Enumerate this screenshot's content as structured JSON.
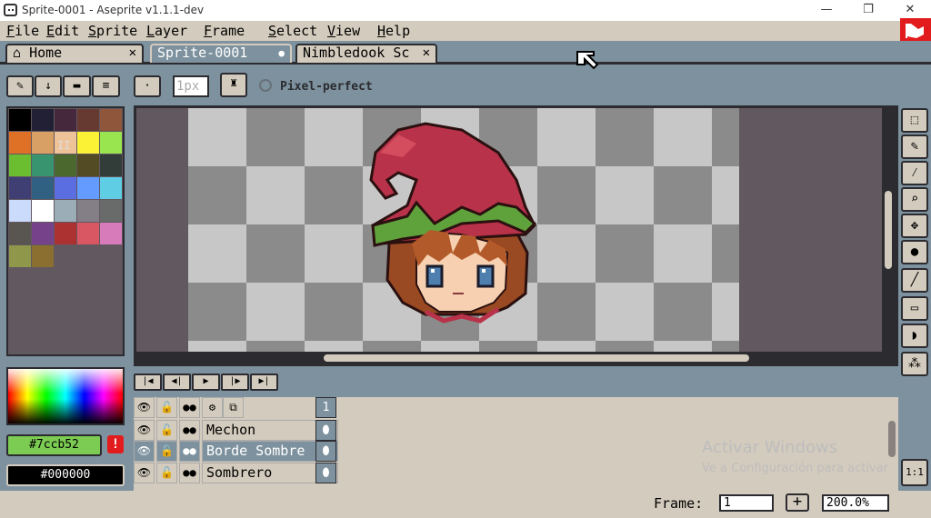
{
  "window": {
    "title": "Sprite-0001 - Aseprite v1.1.1-dev",
    "minimize": "—",
    "maximize": "❐",
    "close": "✕"
  },
  "menu": {
    "file": {
      "u": "F",
      "rest": "ile"
    },
    "edit": {
      "u": "E",
      "rest": "dit"
    },
    "sprite": {
      "u": "S",
      "rest": "prite"
    },
    "layer": {
      "u": "L",
      "rest": "ayer"
    },
    "frame": {
      "u": "F",
      "rest": "rame"
    },
    "select": {
      "u": "S",
      "rest": "elect"
    },
    "view": {
      "u": "V",
      "rest": "iew"
    },
    "help": {
      "u": "H",
      "rest": "elp"
    }
  },
  "tabs": [
    {
      "label": "Home",
      "close": "✕"
    },
    {
      "label": "Sprite-0001",
      "close": "●"
    },
    {
      "label": "Nimbledook Sc",
      "close": "✕"
    }
  ],
  "toolbar": {
    "brush_size": "1px",
    "pixel_perfect": "Pixel-perfect"
  },
  "palette": {
    "colors": [
      "#000000",
      "#222034",
      "#45283c",
      "#663931",
      "#8f563b",
      "#df7126",
      "#d9a066",
      "#eec39a",
      "#fbf236",
      "#99e550",
      "#6abe30",
      "#37946e",
      "#4b692f",
      "#524b24",
      "#323c39",
      "#3f3f74",
      "#306082",
      "#5b6ee1",
      "#639bff",
      "#5fcde4",
      "#cbdbfc",
      "#ffffff",
      "#9badb7",
      "#847e87",
      "#696a6a",
      "#595652",
      "#76428a",
      "#ac3232",
      "#d95763",
      "#d77bba",
      "#8f974a",
      "#8a6f30"
    ],
    "pause": "II"
  },
  "colors": {
    "foreground": "#7ccb52",
    "background": "#000000",
    "warning": "!"
  },
  "timeline": {
    "frame_number": "1",
    "layers": [
      {
        "name": "Mechon",
        "selected": false
      },
      {
        "name": "Borde Sombre",
        "selected": true
      },
      {
        "name": "Sombrero",
        "selected": false
      }
    ]
  },
  "watermark": {
    "line1": "Activar Windows",
    "line2": "Ve a Configuración para activar"
  },
  "statusbar": {
    "frame_label": "Frame:",
    "frame_value": "1",
    "add": "+",
    "zoom": "200.0%"
  },
  "tools": {
    "one_to_one": "1:1"
  }
}
